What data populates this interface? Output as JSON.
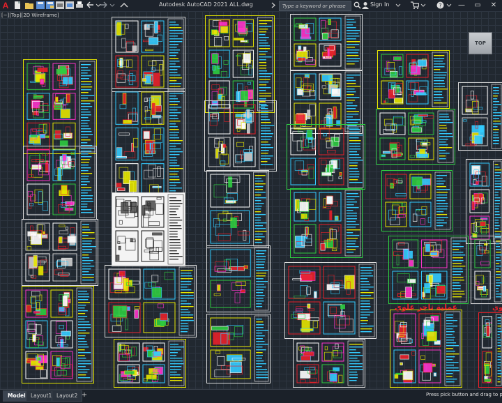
{
  "titlebar": {
    "app_letter": "A",
    "title": "Autodesk AutoCAD 2021    ALL.dwg",
    "search_placeholder": "Type a keyword or phrase",
    "signin_label": "Sign In",
    "minimize": "—",
    "restore": "▭",
    "close": "✕"
  },
  "quick_access": [
    "new-file-icon",
    "open-icon",
    "save-icon",
    "save-as-icon",
    "cloud-open-icon",
    "cloud-save-icon",
    "plot-icon",
    "undo-icon",
    "redo-icon",
    "share-icon"
  ],
  "viewport": {
    "label": "[−][Top][2D Wireframe]",
    "viewcube_label": "TOP",
    "overlay_text": "عملية تاجر علوي",
    "overlay_text_2": "علوي"
  },
  "colors": {
    "background": "#212830",
    "accent_red": "#e8212a",
    "frame_yellow": "#e6e600",
    "frame_green": "#2ecc40",
    "frame_white": "#dcdcdc"
  },
  "statusbar": {
    "tabs": [
      "Model",
      "Layout1",
      "Layout2"
    ],
    "active_tab": "Model",
    "add_tab": "+",
    "message": "Press pick button and drag to pan."
  }
}
